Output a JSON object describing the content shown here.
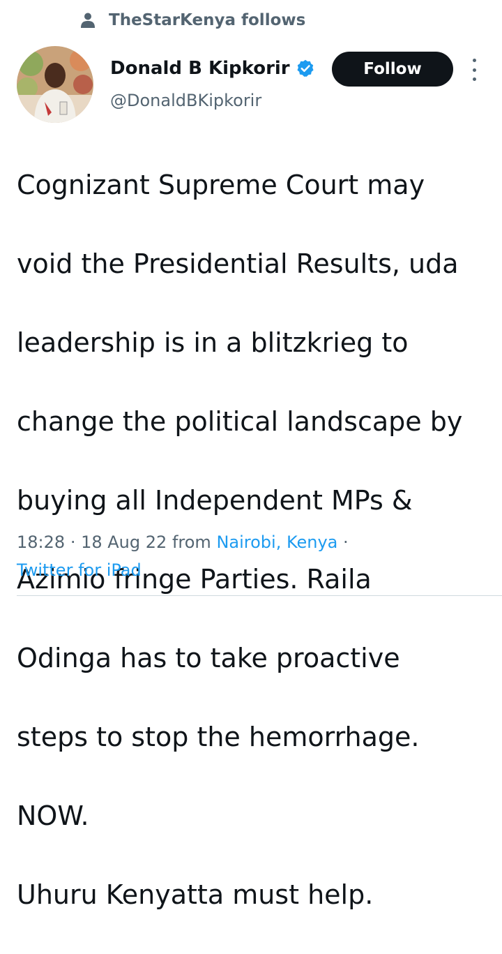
{
  "social_context": {
    "label": "TheStarKenya follows",
    "icon": "person-icon"
  },
  "author": {
    "display_name": "Donald B Kipkorir",
    "handle": "@DonaldBKipkorir",
    "verified": true,
    "verified_color": "#1d9bf0"
  },
  "actions": {
    "follow_label": "Follow",
    "more_icon": "more-vertical-icon"
  },
  "tweet": {
    "lines": [
      "Cognizant Supreme Court may",
      "void the Presidential Results, uda",
      "leadership is in a blitzkrieg to",
      "change the political landscape by",
      "buying all Independent MPs &",
      "Azimio fringe Parties. Raila",
      "Odinga has to take proactive",
      "steps to stop the hemorrhage.",
      "NOW.",
      "Uhuru Kenyatta must help."
    ]
  },
  "meta": {
    "time": "18:28",
    "separator": "·",
    "date": "18 Aug 22",
    "from_label": "from",
    "location": "Nairobi, Kenya",
    "source": "Twitter for iPad"
  },
  "colors": {
    "text": "#0f1419",
    "secondary": "#536471",
    "link": "#1d9bf0",
    "button": "#0f1419"
  }
}
